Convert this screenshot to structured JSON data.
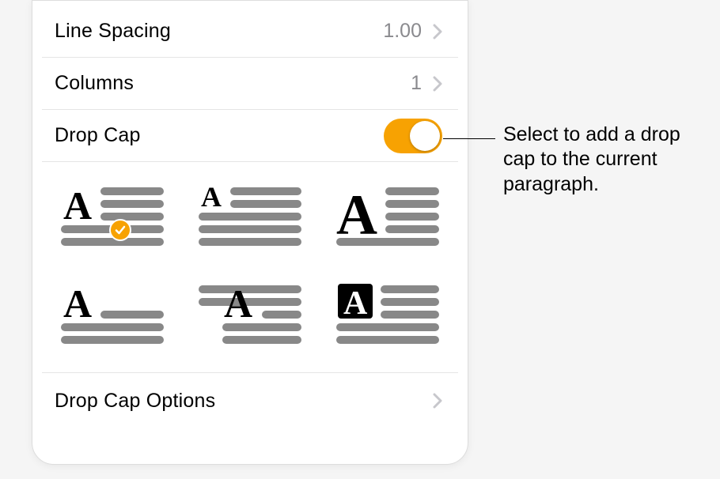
{
  "rows": {
    "line_spacing": {
      "label": "Line Spacing",
      "value": "1.00"
    },
    "columns": {
      "label": "Columns",
      "value": "1"
    },
    "drop_cap": {
      "label": "Drop Cap"
    },
    "drop_cap_options": {
      "label": "Drop Cap Options"
    }
  },
  "callout": "Select to add a drop cap to the current paragraph.",
  "colors": {
    "accent": "#f7a202"
  }
}
